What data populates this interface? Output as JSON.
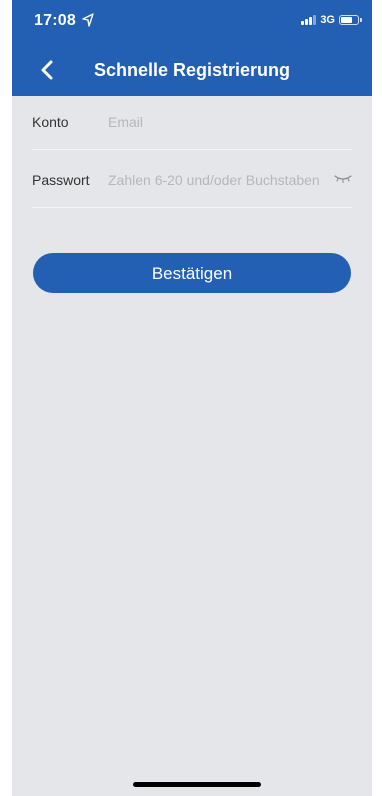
{
  "status_bar": {
    "time": "17:08",
    "network": "3G",
    "location_icon": "location-arrow-icon",
    "signal_icon": "signal-bars-icon",
    "battery_icon": "battery-icon"
  },
  "nav": {
    "title": "Schnelle Registrierung",
    "back_icon": "chevron-left-icon"
  },
  "form": {
    "account_label": "Konto",
    "account_value": "",
    "account_placeholder": "Email",
    "password_label": "Passwort",
    "password_value": "",
    "password_placeholder": "Zahlen 6-20 und/oder Buchstaben",
    "password_toggle_icon": "eye-closed-icon"
  },
  "actions": {
    "confirm_label": "Bestätigen"
  },
  "colors": {
    "primary": "#235fb2",
    "background": "#e4e6e9",
    "placeholder": "#b4b7bc"
  }
}
